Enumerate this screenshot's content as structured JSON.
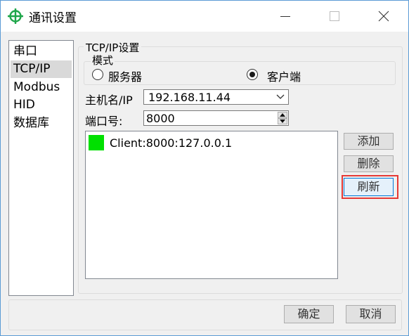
{
  "window": {
    "title": "通讯设置",
    "accent_color": "#1fa64a",
    "icons": {
      "app": "crosshair-icon",
      "minimize": "minimize-icon",
      "maximize": "maximize-icon",
      "close": "close-icon"
    }
  },
  "nav": {
    "items": [
      {
        "label": "串口",
        "selected": false
      },
      {
        "label": "TCP/IP",
        "selected": true
      },
      {
        "label": "Modbus",
        "selected": false
      },
      {
        "label": "HID",
        "selected": false
      },
      {
        "label": "数据库",
        "selected": false
      }
    ]
  },
  "tcpip": {
    "group_title": "TCP/IP设置",
    "mode": {
      "title": "模式",
      "server_label": "服务器",
      "client_label": "客户端",
      "selected": "客户端"
    },
    "host_label": "主机名/IP",
    "host_value": "192.168.11.44",
    "port_label": "端口号:",
    "port_value": "8000",
    "clients": [
      {
        "text": "Client:8000:127.0.0.1",
        "status_color": "#00e000"
      }
    ],
    "add_button": "添加",
    "delete_button": "删除",
    "refresh_button": "刷新"
  },
  "footer": {
    "ok_button": "确定",
    "cancel_button": "取消"
  }
}
